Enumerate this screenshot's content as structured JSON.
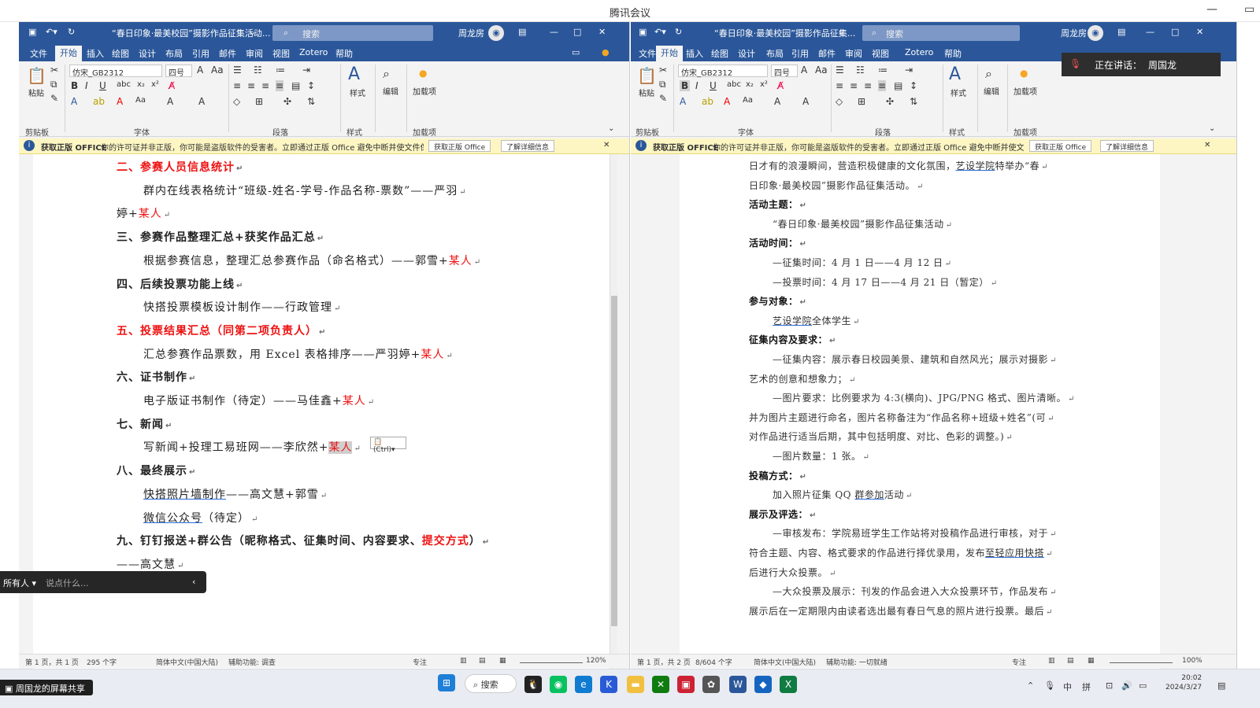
{
  "meeting": {
    "title": "腾讯会议",
    "min": "—",
    "restore": "▭"
  },
  "left_window": {
    "doc_title": "“春日印象·最美校园”摄影作品征集活动...",
    "search": "搜索",
    "user": "周龙房",
    "menu": [
      "文件",
      "开始",
      "插入",
      "绘图",
      "设计",
      "布局",
      "引用",
      "邮件",
      "审阅",
      "视图",
      "Zotero",
      "帮助"
    ],
    "ribbon": {
      "font": "仿宋_GB2312",
      "size": "四号",
      "paste": "粘贴",
      "styles": "样式",
      "edit": "编辑",
      "addins": "加载项",
      "g_clipboard": "剪贴板",
      "g_font": "字体",
      "g_para": "段落",
      "g_style": "样式",
      "g_addin": "加载项"
    },
    "notice": {
      "head": "获取正版 OFFICE",
      "text": "你的许可证并非正版，你可能是盗版软件的受害者。立即通过正版 Office 避免中断并使文件保持安全。",
      "btn1": "获取正版 Office",
      "btn2": "了解详细信息"
    },
    "status": {
      "page": "第 1 页，共 1 页",
      "words": "295 个字",
      "lang": "简体中文(中国大陆)",
      "access": "辅助功能: 调查",
      "focus": "专注",
      "zoom": "120%"
    },
    "paste_chip": "(Ctrl)",
    "lines": [
      {
        "kind": "h",
        "red": true,
        "text": "二、参赛人员信息统计"
      },
      {
        "kind": "b",
        "text": "群内在线表格统计“班级-姓名-学号-作品名称-票数”——严羽"
      },
      {
        "kind": "c",
        "text": "婷+",
        "red_text": "某人"
      },
      {
        "kind": "h",
        "text": "三、参赛作品整理汇总+获奖作品汇总"
      },
      {
        "kind": "b",
        "text": "根据参赛信息，整理汇总参赛作品（命名格式）——郭雪+",
        "red_text": "某人"
      },
      {
        "kind": "h",
        "text": "四、后续投票功能上线"
      },
      {
        "kind": "b",
        "text": "快搭投票模板设计制作——行政管理"
      },
      {
        "kind": "h",
        "red": true,
        "text": "五、投票结果汇总（同第二项负责人）"
      },
      {
        "kind": "b",
        "text": "汇总参赛作品票数，用 Excel 表格排序——严羽婷+",
        "red_text": "某人"
      },
      {
        "kind": "h",
        "text": "六、证书制作"
      },
      {
        "kind": "b",
        "text": "电子版证书制作（待定）——马佳鑫+",
        "red_text": "某人"
      },
      {
        "kind": "h",
        "text": "七、新闻"
      },
      {
        "kind": "b",
        "text": "写新闻+投理工易班网——李欣然+",
        "red_text": "某人",
        "hl": true
      },
      {
        "kind": "h",
        "text": "八、最终展示"
      },
      {
        "kind": "b",
        "text": "快搭照片墙制作——高文慧+郭雪",
        "ul": "快搭照片墙制作"
      },
      {
        "kind": "b",
        "text": "微信公众号（待定）",
        "ul": "微信公众号"
      },
      {
        "kind": "h",
        "text": "九、钉钉报送+群公告（昵称格式、征集时间、内容要求、",
        "red_text": "提交方式",
        "tail": "）"
      },
      {
        "kind": "c",
        "text": "——高文慧"
      }
    ]
  },
  "right_window": {
    "doc_title": "“春日印象·最美校园”摄影作品征集...",
    "search": "搜索",
    "user": "周龙房",
    "menu": [
      "文件",
      "开始",
      "插入",
      "绘图",
      "设计",
      "布局",
      "引用",
      "邮件",
      "审阅",
      "视图",
      "Zotero",
      "帮助"
    ],
    "ribbon": {
      "font": "仿宋_GB2312",
      "size": "四号",
      "paste": "粘贴",
      "styles": "样式",
      "edit": "编辑",
      "addins": "加载项",
      "g_clipboard": "剪贴板",
      "g_font": "字体",
      "g_para": "段落",
      "g_style": "样式",
      "g_addin": "加载项"
    },
    "notice": {
      "head": "获取正版 OFFICE",
      "text": "你的许可证并非正版，你可能是盗版软件的受害者。立即通过正版 Office 避免中断并使文件保持安全。",
      "btn1": "获取正版 Office",
      "btn2": "了解详细信息"
    },
    "status": {
      "page": "第 1 页，共 2 页",
      "words": "8/604 个字",
      "lang": "简体中文(中国大陆)",
      "access": "辅助功能: 一切就绪",
      "focus": "专注",
      "zoom": "100%"
    },
    "lines": [
      {
        "kind": "p",
        "text": "日才有的浪漫瞬间，营造积极健康的文化氛围，",
        "ul": "艺设学院",
        "tail": "特举办“春"
      },
      {
        "kind": "p",
        "text": "日印象·最美校园”摄影作品征集活动。"
      },
      {
        "kind": "h",
        "text": "活动主题："
      },
      {
        "kind": "i",
        "text": "“春日印象·最美校园”摄影作品征集活动"
      },
      {
        "kind": "h",
        "text": "活动时间："
      },
      {
        "kind": "i",
        "text": "—征集时间：4 月 1 日——4 月 12 日"
      },
      {
        "kind": "i",
        "text": "—投票时间：4 月 17 日——4 月 21 日（暂定）"
      },
      {
        "kind": "h",
        "text": "参与对象："
      },
      {
        "kind": "i",
        "text": "",
        "ul": "艺设学院",
        "tail": "全体学生"
      },
      {
        "kind": "h",
        "text": "征集内容及要求："
      },
      {
        "kind": "i",
        "text": "—征集内容：展示春日校园美景、建筑和自然风光；展示对摄影"
      },
      {
        "kind": "p",
        "text": "艺术的创意和想象力；"
      },
      {
        "kind": "i",
        "text": "—图片要求：比例要求为 4:3(横向)、JPG/PNG 格式、图片清晰。"
      },
      {
        "kind": "p",
        "text": "并为图片主题进行命名，图片名称备注为“作品名称+班级+姓名”(可"
      },
      {
        "kind": "p",
        "text": "对作品进行适当后期，其中包括明度、对比、色彩的调整。)"
      },
      {
        "kind": "i",
        "text": "—图片数量：1 张。"
      },
      {
        "kind": "h",
        "text": "投稿方式："
      },
      {
        "kind": "i",
        "text": "加入照片征集 QQ ",
        "ul": "群参加",
        "tail": "活动"
      },
      {
        "kind": "h",
        "text": "展示及评选："
      },
      {
        "kind": "i",
        "text": "—审核发布：学院易班学生工作站将对投稿作品进行审核，对于"
      },
      {
        "kind": "p",
        "text": "符合主题、内容、格式要求的作品进行择优录用，发布",
        "ul": "至轻应用快搭"
      },
      {
        "kind": "p",
        "text": "后进行大众投票。"
      },
      {
        "kind": "i",
        "text": "—大众投票及展示：刊发的作品会进入大众投票环节，作品发布"
      },
      {
        "kind": "p",
        "text": "展示后在一定期限内由读者选出最有春日气息的照片进行投票。最后"
      }
    ]
  },
  "speaking": {
    "label": "正在讲话：",
    "name": "周国龙"
  },
  "chat": {
    "target": "所有人",
    "placeholder": "说点什么..."
  },
  "share_badge": "周国龙的屏幕共享",
  "taskbar": {
    "search": "搜索",
    "time": "20:02",
    "date": "2024/3/27",
    "tray_lang": "中",
    "tray_ime": "拼"
  }
}
